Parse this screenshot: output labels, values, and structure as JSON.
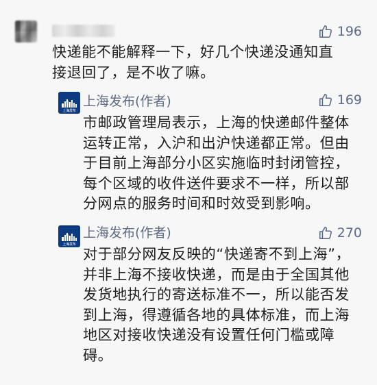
{
  "comments": [
    {
      "author": "",
      "likes": "196",
      "lines": [
        "快递能不能解释一下，好几个快递没通知直",
        "接退回了，是不收了嘛。"
      ]
    },
    {
      "author": "上海发布(作者)",
      "avatar_label": "上海发布",
      "likes": "169",
      "lines": [
        "市邮政管理局表示，上海的快递邮件整体",
        "运转正常，入沪和出沪快递都正常。但由",
        "于目前上海部分小区实施临时封闭管控，",
        "每个区域的收件送件要求不一样，所以部",
        "分网点的服务时间和时效受到影响。"
      ]
    },
    {
      "author": "上海发布(作者)",
      "avatar_label": "上海发布",
      "likes": "270",
      "lines": [
        "对于部分网友反映的“快递寄不到上海”，",
        "并非上海不接收快递，而是由于全国其他",
        "发货地执行的寄送标准不一，所以能否发",
        "到上海，得遵循各地的具体标准，而上海",
        "地区对接收快递没有设置任何门槛或障",
        "碍。"
      ]
    }
  ],
  "icons": {
    "like": "thumbs-up-icon",
    "publisher_avatar": "shanghai-skyline-icon"
  },
  "colors": {
    "background": "#f7f7f7",
    "text": "#1f1f1f",
    "author": "#5f6b82",
    "like": "#5a6a8a",
    "publisher_avatar_bg": "#0d3a80"
  }
}
